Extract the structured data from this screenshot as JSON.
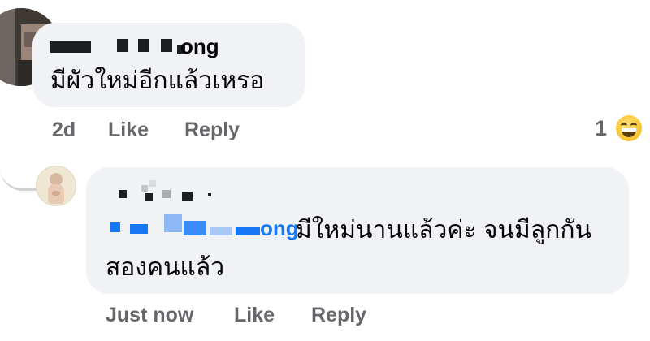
{
  "comments": [
    {
      "author_suffix": "ong",
      "text": "มีผัวใหม่อีกแล้วเหรอ",
      "time": "2d",
      "like_label": "Like",
      "reply_label": "Reply",
      "reaction_count": "1",
      "reaction_icon": "grinning-sweat-emoji"
    },
    {
      "tag_suffix": "ong",
      "text_line1": "มีใหม่นานแล้วค่ะ จนมีลูกกัน",
      "text_line2": "สองคนแล้ว",
      "time": "Just now",
      "like_label": "Like",
      "reply_label": "Reply"
    }
  ],
  "colors": {
    "bubble": "#f0f2f5",
    "link": "#1877f2",
    "meta": "#65676b",
    "text": "#050505"
  }
}
